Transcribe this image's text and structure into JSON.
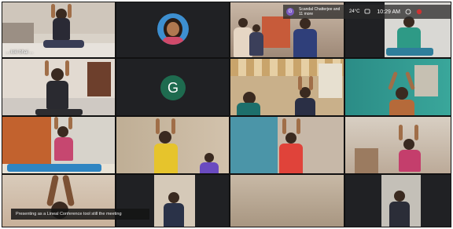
{
  "meeting": {
    "tiles": [
      {
        "id": "t1",
        "name": "....loki bhai ..."
      },
      {
        "id": "t2"
      },
      {
        "id": "t3"
      },
      {
        "id": "t4"
      },
      {
        "id": "t5"
      },
      {
        "id": "t6",
        "avatar_letter": "G"
      },
      {
        "id": "t7"
      },
      {
        "id": "t8"
      }
    ],
    "top_bar": {
      "avatar_letter": "G",
      "presenter_text": "Scandal Chatterjee and 11 more",
      "temperature": "24°C",
      "time": "10:29 AM"
    },
    "caption": "Presenting as a Lineal Conference tool still the meeting"
  },
  "colors": {
    "meet_bg": "#202124",
    "avatar_green": "#1e6b4f",
    "avatar_purple": "#7b5cc0"
  }
}
